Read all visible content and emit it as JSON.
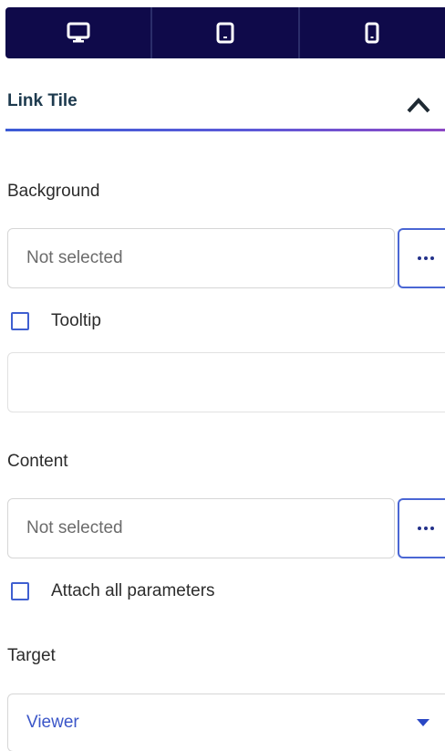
{
  "device_bar": {
    "buttons": [
      {
        "icon": "desktop-icon",
        "active": true
      },
      {
        "icon": "tablet-icon",
        "active": false
      },
      {
        "icon": "mobile-icon",
        "active": false
      }
    ],
    "background_color": "#0f0a4a"
  },
  "section": {
    "title": "Link Tile",
    "collapse_icon": "chevron-up-icon",
    "underline_colors": [
      "#3c5bd6",
      "#8d48c5"
    ]
  },
  "background": {
    "label": "Background",
    "value": "Not selected",
    "picker_icon": "more-dots-icon"
  },
  "tooltip": {
    "label": "Tooltip",
    "checked": false,
    "value": ""
  },
  "content": {
    "label": "Content",
    "value": "Not selected",
    "picker_icon": "more-dots-icon"
  },
  "attach_params": {
    "label": "Attach all parameters",
    "checked": false
  },
  "target": {
    "label": "Target",
    "value": "Viewer",
    "dropdown_icon": "caret-down-icon"
  }
}
